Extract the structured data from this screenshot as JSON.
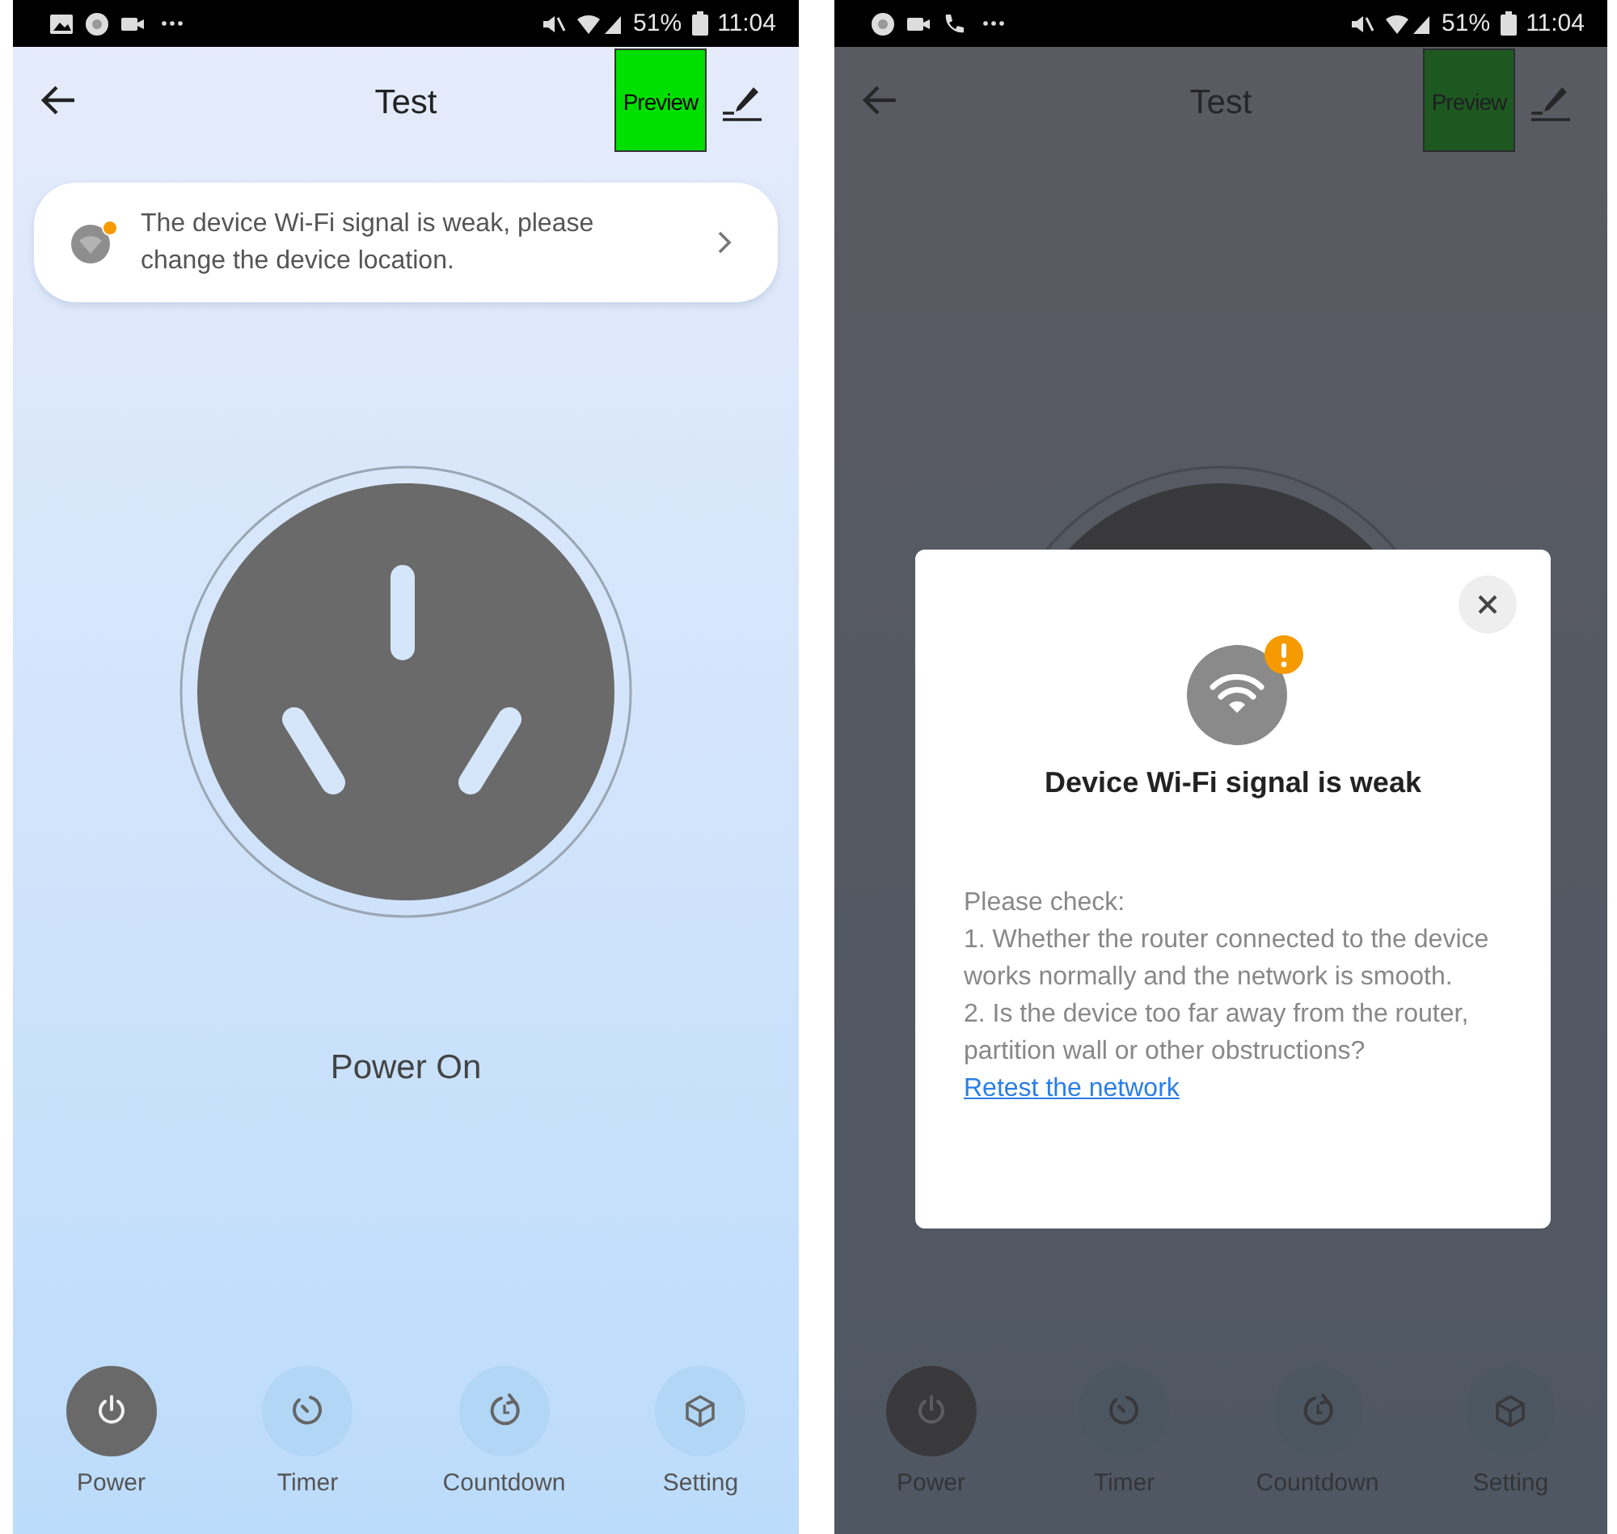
{
  "screens": [
    {
      "status_bar": {
        "battery": "51%",
        "time": "11:04"
      },
      "top_bar": {
        "title": "Test",
        "preview": "Preview"
      },
      "banner": {
        "text": "The device Wi-Fi signal is weak, please change the device location."
      },
      "device": {
        "status": "Power On"
      },
      "nav": [
        {
          "label": "Power",
          "selected": true
        },
        {
          "label": "Timer",
          "selected": false
        },
        {
          "label": "Countdown",
          "selected": false
        },
        {
          "label": "Setting",
          "selected": false
        }
      ]
    },
    {
      "status_bar": {
        "battery": "51%",
        "time": "11:04"
      },
      "top_bar": {
        "title": "Test",
        "preview": "Preview"
      },
      "nav": [
        {
          "label": "Power",
          "selected": true
        },
        {
          "label": "Timer",
          "selected": false
        },
        {
          "label": "Countdown",
          "selected": false
        },
        {
          "label": "Setting",
          "selected": false
        }
      ],
      "dialog": {
        "title": "Device Wi-Fi signal is weak",
        "lines": [
          "Please check:",
          "1. Whether the router connected to the device works normally and the network is smooth.",
          "2. Is the device too far away from the router, partition wall or other obstructions?"
        ],
        "link": "Retest the network"
      }
    }
  ]
}
